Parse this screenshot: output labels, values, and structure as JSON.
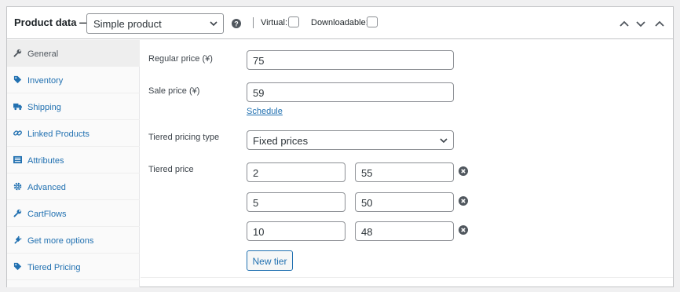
{
  "header": {
    "title": "Product data —",
    "product_type": "Simple product",
    "virtual_label": "Virtual:",
    "downloadable_label": "Downloadable:"
  },
  "sidebar": {
    "items": [
      {
        "label": "General",
        "icon": "wrench-icon",
        "active": true
      },
      {
        "label": "Inventory",
        "icon": "tag-icon",
        "active": false
      },
      {
        "label": "Shipping",
        "icon": "truck-icon",
        "active": false
      },
      {
        "label": "Linked Products",
        "icon": "link-icon",
        "active": false
      },
      {
        "label": "Attributes",
        "icon": "list-icon",
        "active": false
      },
      {
        "label": "Advanced",
        "icon": "gear-icon",
        "active": false
      },
      {
        "label": "CartFlows",
        "icon": "wrench-icon",
        "active": false
      },
      {
        "label": "Get more options",
        "icon": "plugin-icon",
        "active": false
      },
      {
        "label": "Tiered Pricing",
        "icon": "tag-icon",
        "active": false
      }
    ]
  },
  "form": {
    "regular_price_label": "Regular price (¥)",
    "regular_price_value": "75",
    "sale_price_label": "Sale price (¥)",
    "sale_price_value": "59",
    "schedule_link": "Schedule",
    "tiered_type_label": "Tiered pricing type",
    "tiered_type_value": "Fixed prices",
    "tiered_price_label": "Tiered price",
    "tiers": [
      {
        "quantity": "2",
        "price": "55"
      },
      {
        "quantity": "5",
        "price": "50"
      },
      {
        "quantity": "10",
        "price": "48"
      }
    ],
    "new_tier_button": "New tier"
  }
}
